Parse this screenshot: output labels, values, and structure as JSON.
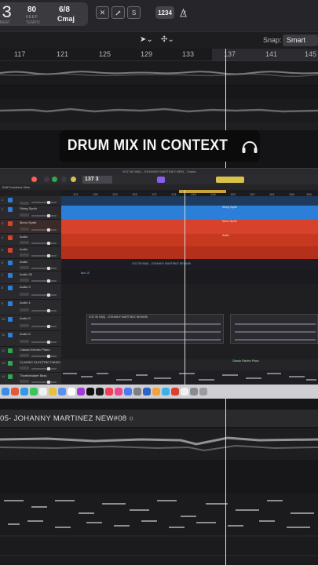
{
  "lcd": {
    "bar": "3",
    "tempo": "80",
    "tempo_sub": "KEEP",
    "tempo_caption": "TEMPO",
    "beat_caption": "BEAT",
    "signature": "6/8",
    "key": "Cmaj"
  },
  "toolbar": {
    "count_in": "1234",
    "snap_label": "Snap:",
    "snap_value": "Smart"
  },
  "ruler": {
    "bars": [
      "117",
      "121",
      "125",
      "129",
      "133",
      "137",
      "141",
      "145"
    ]
  },
  "caption": {
    "text": "DRUM MIX IN CONTEXT"
  },
  "inset": {
    "window_title": "VOZ 08 09(5) - JOHANNY MARTINEZ NEW - Tracks",
    "lcd": "137 3",
    "header_text": "Edit   Functions   View",
    "ruler_bars": [
      "121",
      "125",
      "129",
      "133",
      "137",
      "141",
      "145",
      "149",
      "153",
      "157",
      "161",
      "165",
      "169"
    ],
    "tracks": [
      {
        "num": "1",
        "name": "",
        "color": "#2b7fd8"
      },
      {
        "num": "2",
        "name": "String Synth",
        "color": "#2b7fd8"
      },
      {
        "num": "3",
        "name": "Mono Synth",
        "color": "#d8412b"
      },
      {
        "num": "4",
        "name": "Audio",
        "color": "#d8412b"
      },
      {
        "num": "5",
        "name": "Audio",
        "color": "#d8412b"
      },
      {
        "num": "6",
        "name": "Audio",
        "color": "#2b7fd8"
      },
      {
        "num": "7",
        "name": "Audio 26",
        "color": "#2b7fd8"
      },
      {
        "num": "8",
        "name": "Audio 3",
        "color": "#2b7fd8"
      },
      {
        "num": "9",
        "name": "Audio 4",
        "color": "#2b7fd8"
      },
      {
        "num": "10",
        "name": "Audio 6",
        "color": "#2b7fd8"
      },
      {
        "num": "11",
        "name": "Audio 5",
        "color": "#2b7fd8"
      },
      {
        "num": "12",
        "name": "Classic Electric Piano",
        "color": "#2fa84f"
      },
      {
        "num": "13",
        "name": "CLASSIC ELECTRIC PIANO",
        "color": "#2fa84f"
      },
      {
        "num": "14",
        "name": "Thumbshaker Bass",
        "color": "#2fa84f"
      }
    ],
    "region_labels": {
      "string": "String Synth",
      "mono": "Mono Synth",
      "audio": "Audio",
      "voz_a": "VOZ 08 09(5) - JOHANNY MARTINEZ NEW#08",
      "voz_b": "VOZ 08 09(5) - JOHANNY MARTINEZ NEW#08",
      "piano": "Classic Electric Piano",
      "tail": "Bus 15"
    }
  },
  "bottom": {
    "region_name": "05- JOHANNY MARTINEZ NEW#08  ○"
  },
  "colors": {
    "blue_track": "#2b7fd8",
    "red_track": "#d8412b",
    "green_track": "#2fa84f",
    "accent_purple": "#8a5cf0",
    "cycle_yellow": "#d9c24a"
  }
}
